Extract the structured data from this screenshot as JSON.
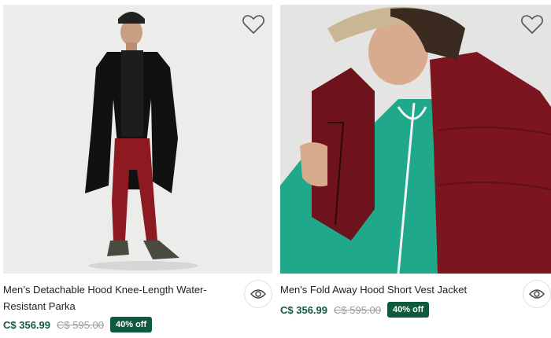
{
  "products": [
    {
      "name": "Men’s Detachable Hood Knee-Length Water-Resistant Parka",
      "price": "C$ 356.99",
      "original_price": "C$ 595.00",
      "discount": "40% off",
      "wishlist_icon": "heart-outline-icon",
      "quick_view_icon": "eye-icon"
    },
    {
      "name": "Men's Fold Away Hood Short Vest Jacket",
      "price": "C$ 356.99",
      "original_price": "C$ 595.00",
      "discount": "40% off",
      "wishlist_icon": "heart-outline-icon",
      "quick_view_icon": "eye-icon"
    }
  ],
  "colors": {
    "price": "#0f5a3d",
    "badge_bg": "#0f5a3d",
    "badge_text": "#ffffff",
    "old_price": "#9a9a9a"
  }
}
